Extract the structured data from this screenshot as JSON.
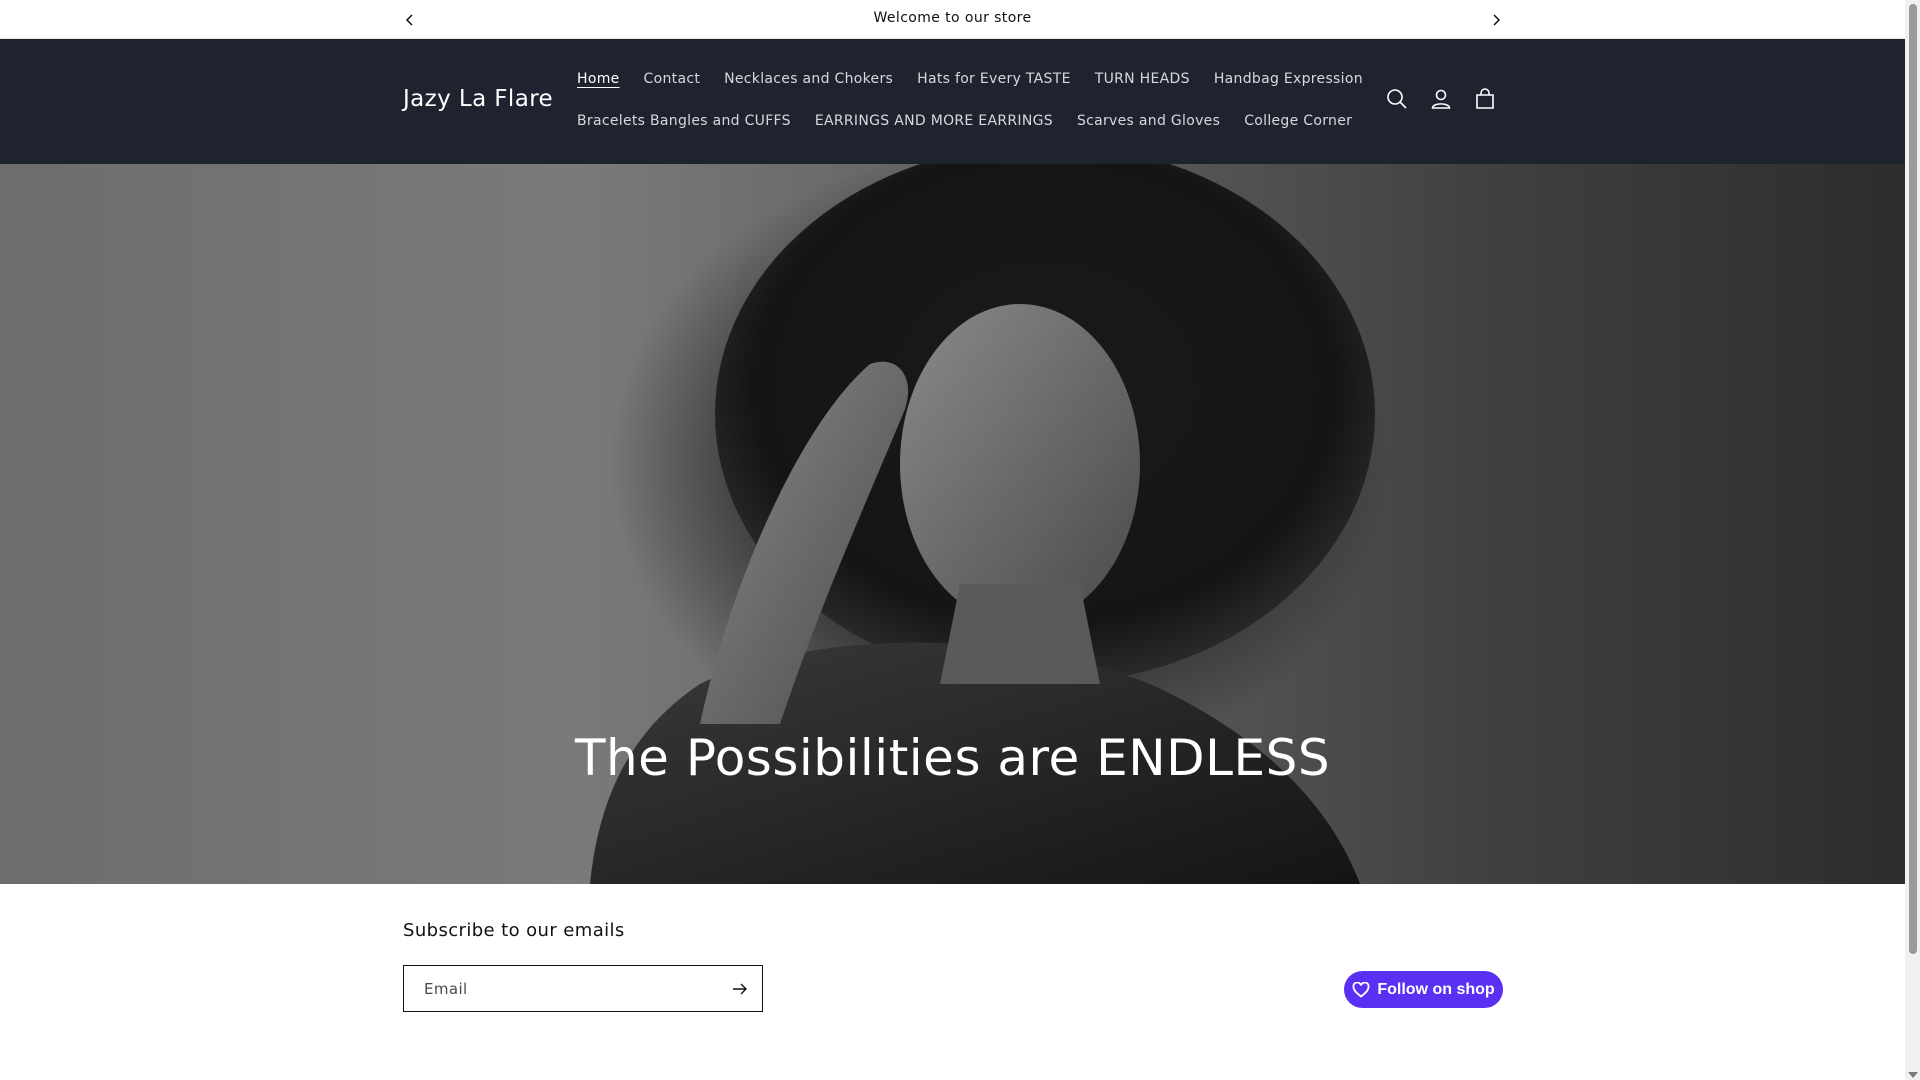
{
  "announcement": {
    "message": "Welcome to our store",
    "prev_icon": "chevron-left-icon",
    "next_icon": "chevron-right-icon"
  },
  "header": {
    "logo": "Jazy La Flare",
    "nav_row1": [
      {
        "label": "Home",
        "active": true
      },
      {
        "label": "Contact"
      },
      {
        "label": "Necklaces and Chokers"
      },
      {
        "label": "Hats for Every TASTE"
      },
      {
        "label": "TURN HEADS"
      },
      {
        "label": "Handbag Expression"
      }
    ],
    "nav_row2": [
      {
        "label": "Bracelets Bangles and CUFFS"
      },
      {
        "label": "EARRINGS AND MORE EARRINGS"
      },
      {
        "label": "Scarves and Gloves"
      },
      {
        "label": "College Corner"
      }
    ],
    "icons": [
      "search-icon",
      "account-icon",
      "cart-icon"
    ],
    "background": "#1f2330"
  },
  "hero": {
    "heading": "The Possibilities are ENDLESS"
  },
  "newsletter": {
    "title": "Subscribe to our emails",
    "email_placeholder": "Email",
    "submit_icon": "arrow-right-icon"
  },
  "shop": {
    "follow_label": "Follow on shop",
    "color": "#5a31f4",
    "icon": "heart-icon"
  }
}
